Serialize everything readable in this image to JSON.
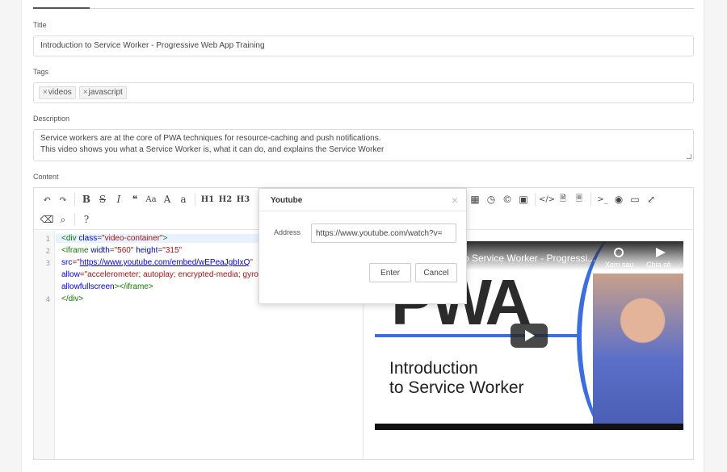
{
  "form": {
    "title_label": "Title",
    "title_value": "Introduction to Service Worker - Progressive Web App Training",
    "tags_label": "Tags",
    "tags": [
      {
        "remove": "×",
        "label": "videos"
      },
      {
        "remove": "×",
        "label": "javascript"
      }
    ],
    "description_label": "Description",
    "description_lines": [
      "Service workers are at the core of PWA techniques for resource-caching and push notifications.",
      "This video shows you what a Service Worker is, what it can do, and explains the Service Worker"
    ],
    "content_label": "Content"
  },
  "toolbar": {
    "row1_left": [
      {
        "name": "undo-icon",
        "glyph": "↶"
      },
      {
        "name": "redo-icon",
        "glyph": "↷"
      },
      {
        "sep": true
      },
      {
        "name": "bold-icon",
        "glyph": "B"
      },
      {
        "name": "strikethrough-icon",
        "glyph": "S"
      },
      {
        "name": "italic-icon",
        "glyph": "I"
      },
      {
        "name": "quote-icon",
        "glyph": "❝"
      },
      {
        "name": "font-case-icon",
        "glyph": "Aa"
      },
      {
        "name": "uppercase-icon",
        "glyph": "A"
      },
      {
        "name": "lowercase-icon",
        "glyph": "a"
      },
      {
        "sep": true
      },
      {
        "name": "heading1-icon",
        "glyph": "H1"
      },
      {
        "name": "heading2-icon",
        "glyph": "H2"
      },
      {
        "name": "heading3-icon",
        "glyph": "H3"
      }
    ],
    "row1_right": [
      {
        "name": "table-icon",
        "glyph": "▦"
      },
      {
        "name": "clock-icon",
        "glyph": "◷"
      },
      {
        "name": "copyright-icon",
        "glyph": "©"
      },
      {
        "name": "image-icon",
        "glyph": "▣"
      },
      {
        "sep": true
      },
      {
        "name": "code-icon",
        "glyph": "</>"
      },
      {
        "name": "file-code-icon",
        "glyph": "🗎"
      },
      {
        "name": "file-text-icon",
        "glyph": "🗏"
      },
      {
        "sep": true
      },
      {
        "name": "terminal-icon",
        "glyph": ">_"
      },
      {
        "name": "preview-eye-icon",
        "glyph": "◉"
      },
      {
        "name": "monitor-icon",
        "glyph": "▭"
      },
      {
        "name": "fullscreen-icon",
        "glyph": "⤢"
      }
    ],
    "row2": [
      {
        "name": "eraser-icon",
        "glyph": "⌫"
      },
      {
        "name": "search-icon",
        "glyph": "⌕"
      },
      {
        "sep": true
      },
      {
        "name": "help-icon",
        "glyph": "?"
      }
    ]
  },
  "code": {
    "line_numbers": [
      "1",
      "2",
      "3",
      "4"
    ],
    "l1": {
      "open": "<div ",
      "attr": "class",
      "eq": "=",
      "val": "\"video-container\"",
      "close": ">"
    },
    "l2": {
      "open": "<iframe ",
      "a1": "width",
      "v1": "\"560\"",
      "a2": "height",
      "v2": "\"315\""
    },
    "l3a": {
      "attr": "src",
      "q": "=\"",
      "url": "https://www.youtube.com/embed/wEPeaJgbIxQ",
      "end": "\""
    },
    "l3b": {
      "attr": "allow",
      "val": "=\"accelerometer; autoplay; encrypted-media; gyro"
    },
    "l3c": {
      "attr": "allowfullscreen",
      "close": "></iframe>"
    },
    "l4": {
      "close": "</div>"
    }
  },
  "video": {
    "title": "o Service Worker - Progressi...",
    "watch_later": "Xem sau",
    "share": "Chia sẻ",
    "logo": "PWA",
    "heading_line1": "Introduction",
    "heading_line2": "to Service Worker"
  },
  "modal": {
    "title": "Youtube",
    "close": "×",
    "address_label": "Address",
    "address_value": "https://www.youtube.com/watch?v=",
    "enter": "Enter",
    "cancel": "Cancel"
  }
}
